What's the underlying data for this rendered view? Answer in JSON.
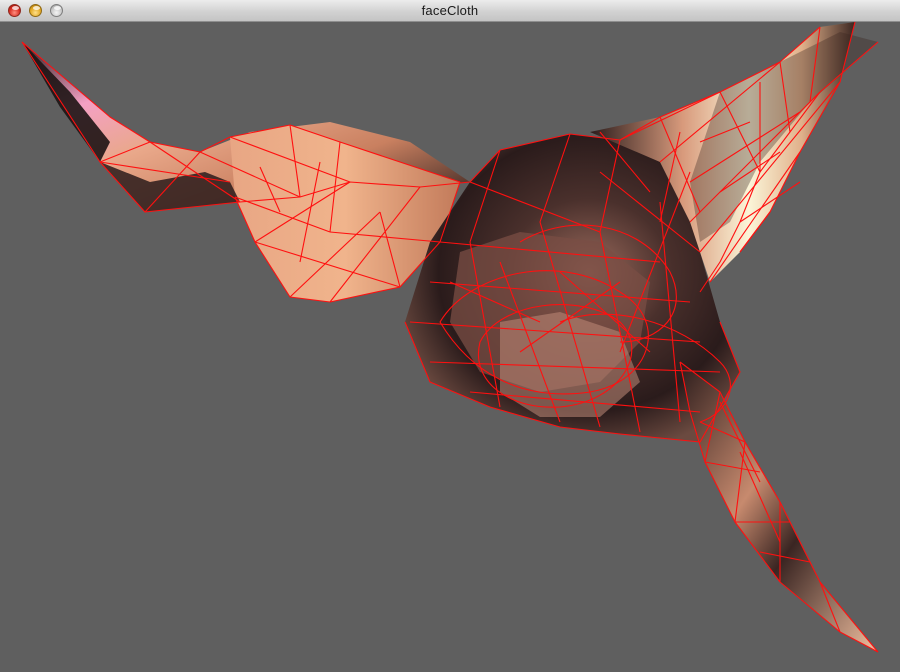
{
  "window": {
    "title": "faceCloth",
    "controls": {
      "close": "close-button",
      "minimize": "minimize-button",
      "zoom": "zoom-button"
    }
  },
  "viewport": {
    "background_color": "#5f5f5f",
    "mesh_color": "#ff1010",
    "skin_light": "#f0b48c",
    "skin_mid": "#c98060",
    "shadow": "#2a1b1b",
    "highlight_pink": "#f4a0c4",
    "highlight_cream": "#fbf5d8"
  }
}
